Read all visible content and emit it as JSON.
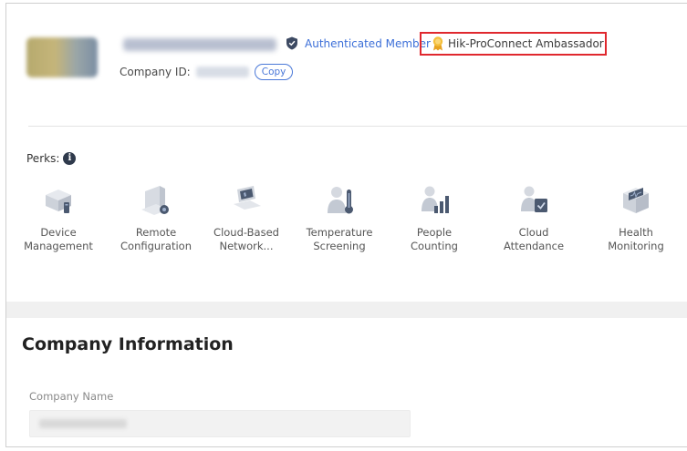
{
  "header": {
    "company_id_label": "Company ID:",
    "copy_label": "Copy",
    "authenticated_label": "Authenticated Member",
    "ambassador_label": "Hik-ProConnect Ambassador",
    "shield_icon": "shield-icon",
    "medal_icon": "medal-icon"
  },
  "perks": {
    "label": "Perks:",
    "info_icon": "info-icon",
    "items": [
      {
        "label": "Device\nManagement",
        "icon": "device-management-icon"
      },
      {
        "label": "Remote\nConfiguration",
        "icon": "remote-configuration-icon"
      },
      {
        "label": "Cloud-Based\nNetwork...",
        "icon": "cloud-network-icon"
      },
      {
        "label": "Temperature\nScreening",
        "icon": "temperature-screening-icon"
      },
      {
        "label": "People\nCounting",
        "icon": "people-counting-icon"
      },
      {
        "label": "Cloud\nAttendance",
        "icon": "cloud-attendance-icon"
      },
      {
        "label": "Health\nMonitoring",
        "icon": "health-monitoring-icon"
      }
    ]
  },
  "company_info": {
    "title": "Company Information",
    "name_label": "Company Name"
  },
  "colors": {
    "accent": "#3c6fd8",
    "highlight_border": "#e0282e",
    "medal": "#f0b52c"
  }
}
